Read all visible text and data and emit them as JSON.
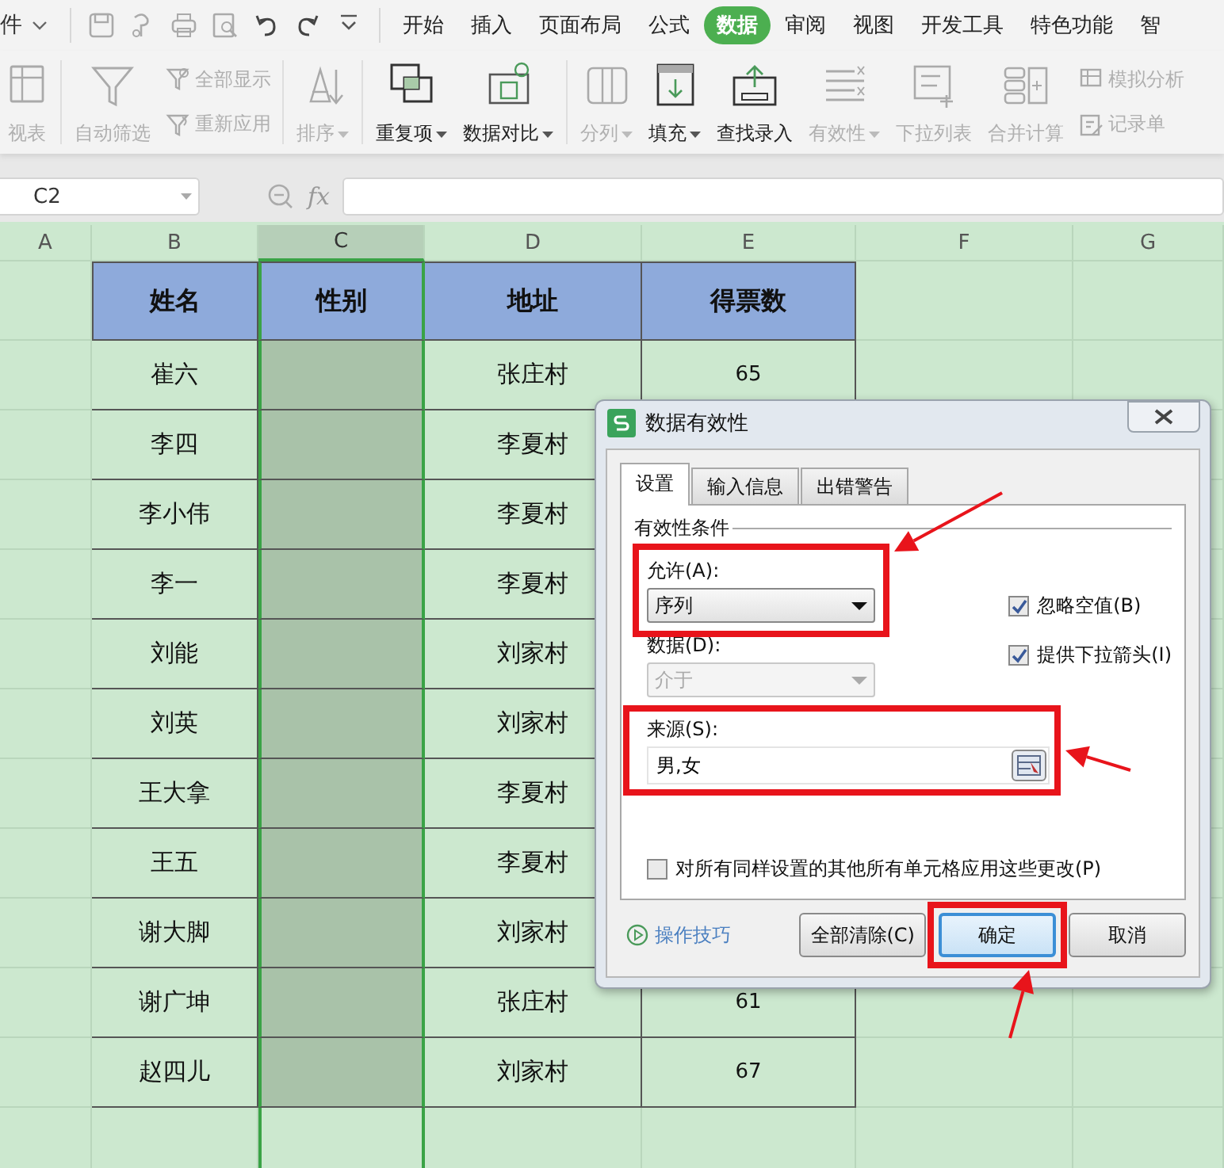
{
  "file_menu": {
    "label": "件"
  },
  "tabs": [
    {
      "label": "开始",
      "selected": false
    },
    {
      "label": "插入",
      "selected": false
    },
    {
      "label": "页面布局",
      "selected": false
    },
    {
      "label": "公式",
      "selected": false
    },
    {
      "label": "数据",
      "selected": true
    },
    {
      "label": "审阅",
      "selected": false
    },
    {
      "label": "视图",
      "selected": false
    },
    {
      "label": "开发工具",
      "selected": false
    },
    {
      "label": "特色功能",
      "selected": false
    },
    {
      "label": "智",
      "selected": false
    }
  ],
  "ribbon": [
    {
      "kind": "large",
      "label": "视表",
      "disabled": true,
      "dropdown": false
    },
    {
      "kind": "divider"
    },
    {
      "kind": "large",
      "label": "自动筛选",
      "disabled": true,
      "dropdown": false
    },
    {
      "kind": "pair",
      "items": [
        {
          "label": "全部显示",
          "disabled": true
        },
        {
          "label": "重新应用",
          "disabled": true
        }
      ]
    },
    {
      "kind": "divider"
    },
    {
      "kind": "large",
      "label": "排序",
      "disabled": true,
      "dropdown": true
    },
    {
      "kind": "divider"
    },
    {
      "kind": "large",
      "label": "重复项",
      "disabled": false,
      "dropdown": true
    },
    {
      "kind": "large",
      "label": "数据对比",
      "disabled": false,
      "dropdown": true
    },
    {
      "kind": "divider"
    },
    {
      "kind": "large",
      "label": "分列",
      "disabled": true,
      "dropdown": true
    },
    {
      "kind": "large",
      "label": "填充",
      "disabled": false,
      "dropdown": true
    },
    {
      "kind": "large",
      "label": "查找录入",
      "disabled": false,
      "dropdown": false
    },
    {
      "kind": "large",
      "label": "有效性",
      "disabled": true,
      "dropdown": true
    },
    {
      "kind": "large",
      "label": "下拉列表",
      "disabled": true,
      "dropdown": false
    },
    {
      "kind": "large",
      "label": "合并计算",
      "disabled": true,
      "dropdown": false
    },
    {
      "kind": "pair",
      "items": [
        {
          "label": "模拟分析",
          "disabled": true
        },
        {
          "label": "记录单",
          "disabled": true
        }
      ]
    }
  ],
  "formula_bar": {
    "name_box": "C2",
    "function_label": "fx"
  },
  "columns": [
    {
      "label": "A",
      "selected": false
    },
    {
      "label": "B",
      "selected": false
    },
    {
      "label": "C",
      "selected": true
    },
    {
      "label": "D",
      "selected": false
    },
    {
      "label": "E",
      "selected": false
    },
    {
      "label": "F",
      "selected": false
    },
    {
      "label": "G",
      "selected": false
    }
  ],
  "table": {
    "header": [
      "姓名",
      "性别",
      "地址",
      "得票数"
    ],
    "rows": [
      {
        "name": "崔六",
        "address": "张庄村",
        "votes": "65"
      },
      {
        "name": "李四",
        "address": "李夏村"
      },
      {
        "name": "李小伟",
        "address": "李夏村"
      },
      {
        "name": "李一",
        "address": "李夏村"
      },
      {
        "name": "刘能",
        "address": "刘家村"
      },
      {
        "name": "刘英",
        "address": "刘家村"
      },
      {
        "name": "王大拿",
        "address": "李夏村"
      },
      {
        "name": "王五",
        "address": "李夏村"
      },
      {
        "name": "谢大脚",
        "address": "刘家村"
      },
      {
        "name": "谢广坤",
        "address": "张庄村",
        "votes": "61"
      },
      {
        "name": "赵四儿",
        "address": "刘家村",
        "votes": "67"
      }
    ]
  },
  "dialog": {
    "title": "数据有效性",
    "tabs": [
      {
        "label": "设置",
        "selected": true
      },
      {
        "label": "输入信息",
        "selected": false
      },
      {
        "label": "出错警告",
        "selected": false
      }
    ],
    "section": "有效性条件",
    "allow": {
      "label": "允许(A):",
      "value": "序列",
      "disabled": false
    },
    "data": {
      "label": "数据(D):",
      "value": "介于",
      "disabled": true
    },
    "options": [
      {
        "label": "忽略空值(B)",
        "checked": true
      },
      {
        "label": "提供下拉箭头(I)",
        "checked": true
      }
    ],
    "source": {
      "label": "来源(S):",
      "value": "男,女"
    },
    "apply_all": {
      "label": "对所有同样设置的其他所有单元格应用这些更改(P)",
      "checked": false
    },
    "tips_link": "操作技巧",
    "buttons": [
      {
        "label": "全部清除(C)",
        "default": false
      },
      {
        "label": "确定",
        "default": true
      },
      {
        "label": "取消",
        "default": false
      }
    ]
  }
}
